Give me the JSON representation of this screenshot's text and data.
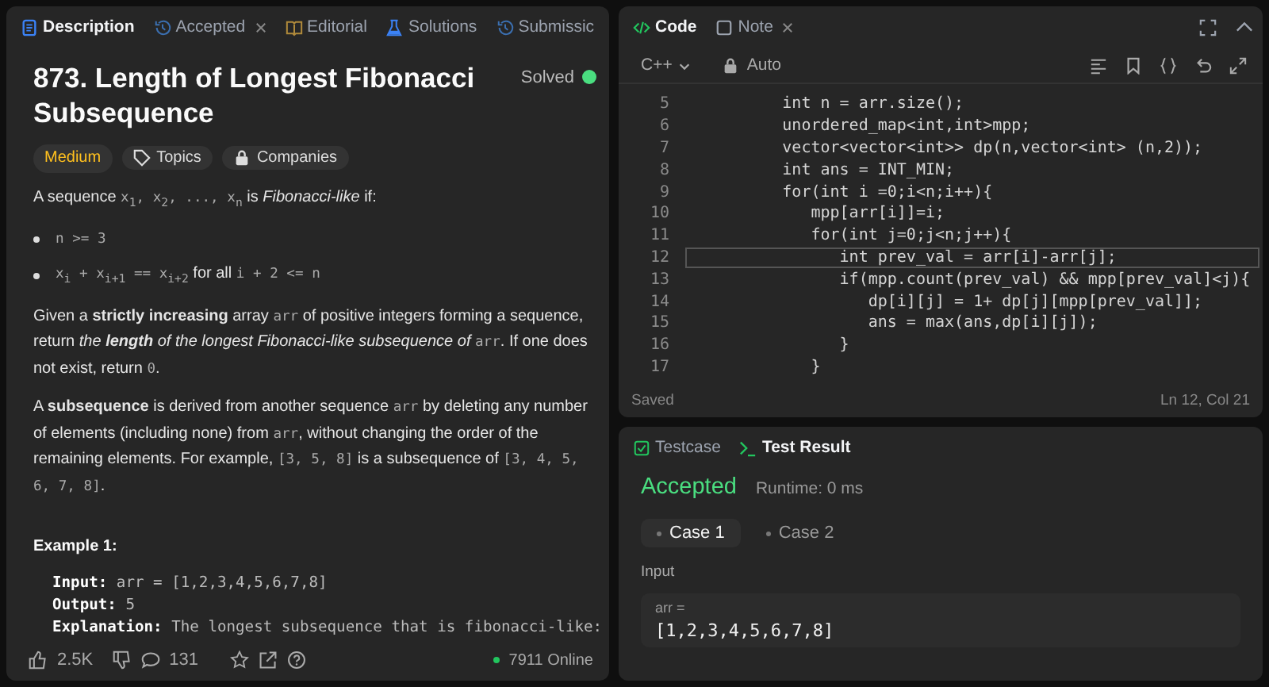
{
  "left_panel": {
    "tabs": [
      {
        "label": "Description",
        "kind": "document",
        "selected": true,
        "closable": false
      },
      {
        "label": "Accepted",
        "kind": "history",
        "selected": false,
        "closable": true
      },
      {
        "label": "Editorial",
        "kind": "book",
        "selected": false,
        "closable": false
      },
      {
        "label": "Solutions",
        "kind": "flask",
        "selected": false,
        "closable": false
      },
      {
        "label": "Submissic",
        "kind": "history",
        "selected": false,
        "closable": false
      }
    ],
    "title": "873. Length of Longest Fibonacci Subsequence",
    "status": "Solved",
    "difficulty": "Medium",
    "tags": [
      "Topics",
      "Companies"
    ],
    "paragraphs": [
      {
        "kind": "para",
        "segments": [
          {
            "kind": "text",
            "text": "A sequence "
          },
          {
            "kind": "code",
            "text": "x$_{1}$, x$_{2}$, ..., x$_{n}$"
          },
          {
            "kind": "text",
            "text": " is *Fibonacci-like* if:"
          }
        ]
      },
      {
        "kind": "bullet",
        "segments": [
          {
            "kind": "code",
            "text": "n >= 3"
          }
        ]
      },
      {
        "kind": "bullet",
        "segments": [
          {
            "kind": "code",
            "text": "x$_{i}$ + x$_{i+1}$ == x$_{i+2}$"
          },
          {
            "kind": "text",
            "text": " for all "
          },
          {
            "kind": "code",
            "text": "i + 2 <= n"
          }
        ]
      },
      {
        "kind": "para",
        "segments": [
          {
            "kind": "text",
            "text": "Given a **strictly increasing** array "
          },
          {
            "kind": "code",
            "text": "arr"
          },
          {
            "kind": "text",
            "text": " of positive integers forming a sequence, return "
          },
          {
            "kind": "em",
            "text": "the **length** of the longest Fibonacci-like subsequence of "
          },
          {
            "kind": "code",
            "text": "arr"
          },
          {
            "kind": "text",
            "text": ". If one does not exist, return "
          },
          {
            "kind": "code",
            "text": "0"
          },
          {
            "kind": "text",
            "text": "."
          }
        ]
      },
      {
        "kind": "para",
        "segments": [
          {
            "kind": "text",
            "text": "A **subsequence** is derived from another sequence "
          },
          {
            "kind": "code",
            "text": "arr"
          },
          {
            "kind": "text",
            "text": " by deleting any number of elements (including none) from "
          },
          {
            "kind": "code",
            "text": "arr"
          },
          {
            "kind": "text",
            "text": ", without changing the order of the remaining elements. For example, "
          },
          {
            "kind": "code",
            "text": "[3, 5, 8]"
          },
          {
            "kind": "text",
            "text": " is a subsequence of "
          },
          {
            "kind": "code",
            "text": "[3, 4, 5, 6, 7, 8]"
          },
          {
            "kind": "text",
            "text": "."
          }
        ]
      }
    ],
    "example": {
      "title": "Example 1:",
      "lines": [
        {
          "label": "Input:",
          "value": "arr = [1,2,3,4,5,6,7,8]"
        },
        {
          "label": "Output:",
          "value": "5"
        },
        {
          "label": "Explanation:",
          "value": "The longest subsequence that is fibonacci-like:"
        }
      ]
    },
    "footer": {
      "likes": "2.5K",
      "comments": "131",
      "online": "7911 Online"
    }
  },
  "editor": {
    "tabs": [
      {
        "label": "Code",
        "selected": true,
        "closable": false
      },
      {
        "label": "Note",
        "selected": false,
        "closable": true
      }
    ],
    "language": "C++",
    "mode": "Auto",
    "lines": [
      {
        "n": "5",
        "code": "        int n = arr.size();",
        "current": false
      },
      {
        "n": "6",
        "code": "        unordered_map<int,int>mpp;",
        "current": false
      },
      {
        "n": "7",
        "code": "        vector<vector<int>> dp(n,vector<int> (n,2));",
        "current": false
      },
      {
        "n": "8",
        "code": "        int ans = INT_MIN;",
        "current": false
      },
      {
        "n": "9",
        "code": "        for(int i =0;i<n;i++){",
        "current": false
      },
      {
        "n": "10",
        "code": "           mpp[arr[i]]=i;",
        "current": false
      },
      {
        "n": "11",
        "code": "           for(int j=0;j<n;j++){",
        "current": false
      },
      {
        "n": "12",
        "code": "              int prev_val = arr[i]-arr[j];",
        "current": true
      },
      {
        "n": "13",
        "code": "              if(mpp.count(prev_val) && mpp[prev_val]<j){",
        "current": false
      },
      {
        "n": "14",
        "code": "                 dp[i][j] = 1+ dp[j][mpp[prev_val]];",
        "current": false
      },
      {
        "n": "15",
        "code": "                 ans = max(ans,dp[i][j]);",
        "current": false
      },
      {
        "n": "16",
        "code": "              }",
        "current": false
      },
      {
        "n": "17",
        "code": "           }",
        "current": false
      }
    ],
    "status": "Saved",
    "cursor": "Ln 12, Col 21"
  },
  "results": {
    "tabs": [
      {
        "label": "Testcase",
        "selected": false
      },
      {
        "label": "Test Result",
        "selected": true
      }
    ],
    "verdict": "Accepted",
    "runtime": "Runtime: 0 ms",
    "cases": [
      {
        "label": "Case 1",
        "selected": true
      },
      {
        "label": "Case 2",
        "selected": false
      }
    ],
    "input_label": "Input",
    "param": "arr =",
    "value": "[1,2,3,4,5,6,7,8]"
  }
}
